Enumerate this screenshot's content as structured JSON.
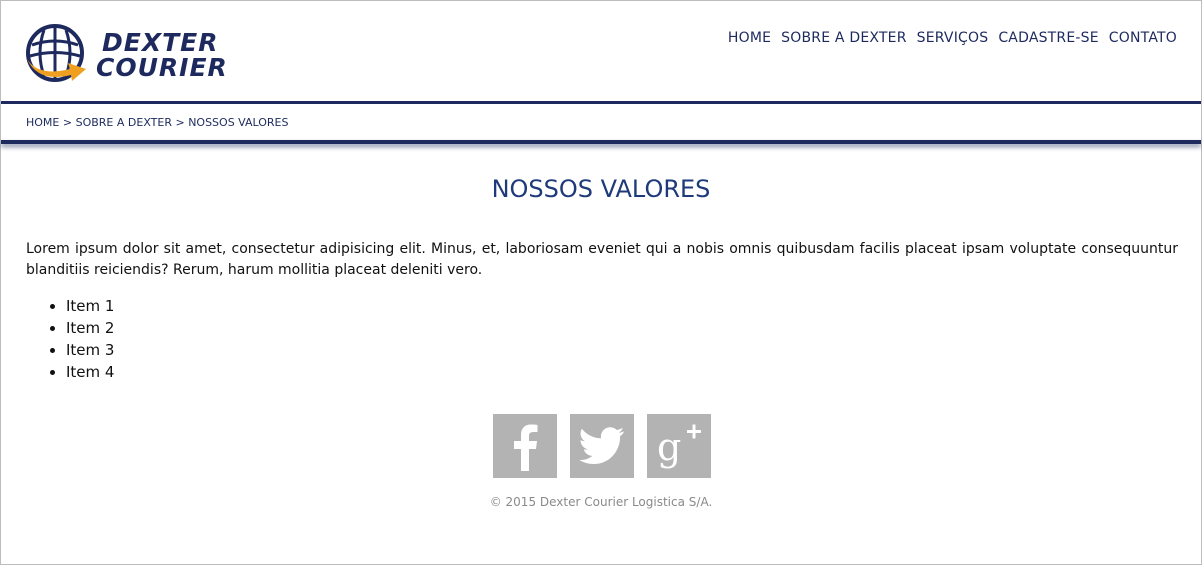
{
  "brand": {
    "line1": "DEXTER",
    "line2": "COURIER",
    "colors": {
      "navy": "#1e2a5e",
      "orange": "#f0a020"
    }
  },
  "nav": {
    "items": [
      "HOME",
      "SOBRE A DEXTER",
      "SERVIÇOS",
      "CADASTRE-SE",
      "CONTATO"
    ]
  },
  "breadcrumb": {
    "items": [
      "HOME",
      "SOBRE A DEXTER",
      "NOSSOS VALORES"
    ],
    "separator": ">"
  },
  "main": {
    "title": "NOSSOS VALORES",
    "intro": "Lorem ipsum dolor sit amet, consectetur adipisicing elit. Minus, et, laboriosam eveniet qui a nobis omnis quibusdam facilis placeat ipsam voluptate consequuntur blanditiis reiciendis? Rerum, harum mollitia placeat deleniti vero.",
    "list": [
      "Item 1",
      "Item 2",
      "Item 3",
      "Item 4"
    ]
  },
  "social": {
    "icons": [
      "facebook-icon",
      "twitter-icon",
      "google-plus-icon"
    ],
    "color": "#b3b3b3"
  },
  "footer": {
    "copyright": "© 2015 Dexter Courier Logistica S/A."
  }
}
